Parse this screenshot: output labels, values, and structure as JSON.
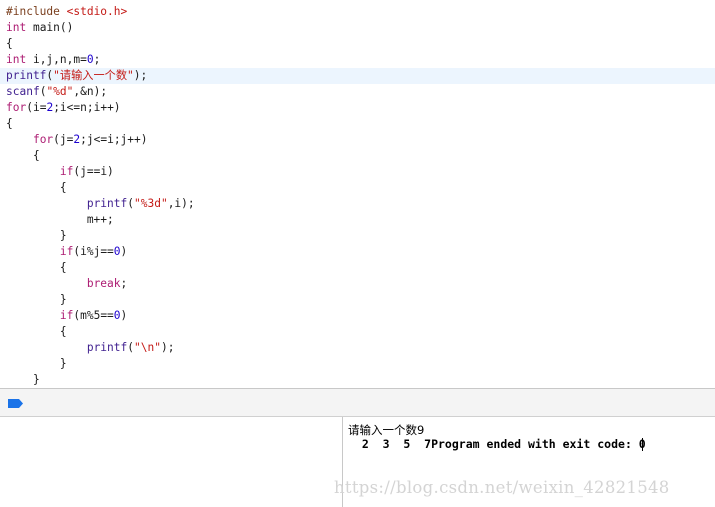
{
  "editor": {
    "lines": [
      [
        {
          "t": "#include ",
          "c": "pp"
        },
        {
          "t": "<stdio.h>",
          "c": "inc"
        }
      ],
      [
        {
          "t": "int",
          "c": "kw"
        },
        {
          "t": " main()",
          "c": "pl"
        }
      ],
      [
        {
          "t": "{",
          "c": "pl"
        }
      ],
      [
        {
          "t": "int",
          "c": "kw"
        },
        {
          "t": " i,j,n,m=",
          "c": "pl"
        },
        {
          "t": "0",
          "c": "num"
        },
        {
          "t": ";",
          "c": "pl"
        }
      ],
      [
        {
          "t": "printf",
          "c": "fn"
        },
        {
          "t": "(",
          "c": "pl"
        },
        {
          "t": "\"请输入一个数\"",
          "c": "str"
        },
        {
          "t": ");",
          "c": "pl"
        }
      ],
      [
        {
          "t": "scanf",
          "c": "fn"
        },
        {
          "t": "(",
          "c": "pl"
        },
        {
          "t": "\"%d\"",
          "c": "str"
        },
        {
          "t": ",&n);",
          "c": "pl"
        }
      ],
      [
        {
          "t": "for",
          "c": "kw"
        },
        {
          "t": "(i=",
          "c": "pl"
        },
        {
          "t": "2",
          "c": "num"
        },
        {
          "t": ";i<=n;i++)",
          "c": "pl"
        }
      ],
      [
        {
          "t": "{",
          "c": "pl"
        }
      ],
      [
        {
          "t": "    ",
          "c": "pl"
        },
        {
          "t": "for",
          "c": "kw"
        },
        {
          "t": "(j=",
          "c": "pl"
        },
        {
          "t": "2",
          "c": "num"
        },
        {
          "t": ";j<=i;j++)",
          "c": "pl"
        }
      ],
      [
        {
          "t": "    {",
          "c": "pl"
        }
      ],
      [
        {
          "t": "        ",
          "c": "pl"
        },
        {
          "t": "if",
          "c": "kw"
        },
        {
          "t": "(j==i)",
          "c": "pl"
        }
      ],
      [
        {
          "t": "        {",
          "c": "pl"
        }
      ],
      [
        {
          "t": "            ",
          "c": "pl"
        },
        {
          "t": "printf",
          "c": "fn"
        },
        {
          "t": "(",
          "c": "pl"
        },
        {
          "t": "\"%3d\"",
          "c": "str"
        },
        {
          "t": ",i);",
          "c": "pl"
        }
      ],
      [
        {
          "t": "            m++;",
          "c": "pl"
        }
      ],
      [
        {
          "t": "        }",
          "c": "pl"
        }
      ],
      [
        {
          "t": "        ",
          "c": "pl"
        },
        {
          "t": "if",
          "c": "kw"
        },
        {
          "t": "(i%j==",
          "c": "pl"
        },
        {
          "t": "0",
          "c": "num"
        },
        {
          "t": ")",
          "c": "pl"
        }
      ],
      [
        {
          "t": "        {",
          "c": "pl"
        }
      ],
      [
        {
          "t": "            ",
          "c": "pl"
        },
        {
          "t": "break",
          "c": "kw"
        },
        {
          "t": ";",
          "c": "pl"
        }
      ],
      [
        {
          "t": "        }",
          "c": "pl"
        }
      ],
      [
        {
          "t": "        ",
          "c": "pl"
        },
        {
          "t": "if",
          "c": "kw"
        },
        {
          "t": "(m%5==",
          "c": "pl"
        },
        {
          "t": "0",
          "c": "num"
        },
        {
          "t": ")",
          "c": "pl"
        }
      ],
      [
        {
          "t": "        {",
          "c": "pl"
        }
      ],
      [
        {
          "t": "            ",
          "c": "pl"
        },
        {
          "t": "printf",
          "c": "fn"
        },
        {
          "t": "(",
          "c": "pl"
        },
        {
          "t": "\"\\n\"",
          "c": "str"
        },
        {
          "t": ");",
          "c": "pl"
        }
      ],
      [
        {
          "t": "        }",
          "c": "pl"
        }
      ],
      [
        {
          "t": "    }",
          "c": "pl"
        }
      ]
    ],
    "highlighted_line": 4
  },
  "console": {
    "prompt_line": "请输入一个数9",
    "output_line": "  2  3  5  7Program ended with exit code: 0"
  },
  "watermark": "https://blog.csdn.net/weixin_42821548",
  "colors": {
    "keyword": "#ad1d73",
    "string": "#c41a16",
    "number": "#1c00cf",
    "function": "#3f1f8f",
    "line_highlight": "#ecf5fe",
    "breakpoint": "#1a73e8"
  }
}
